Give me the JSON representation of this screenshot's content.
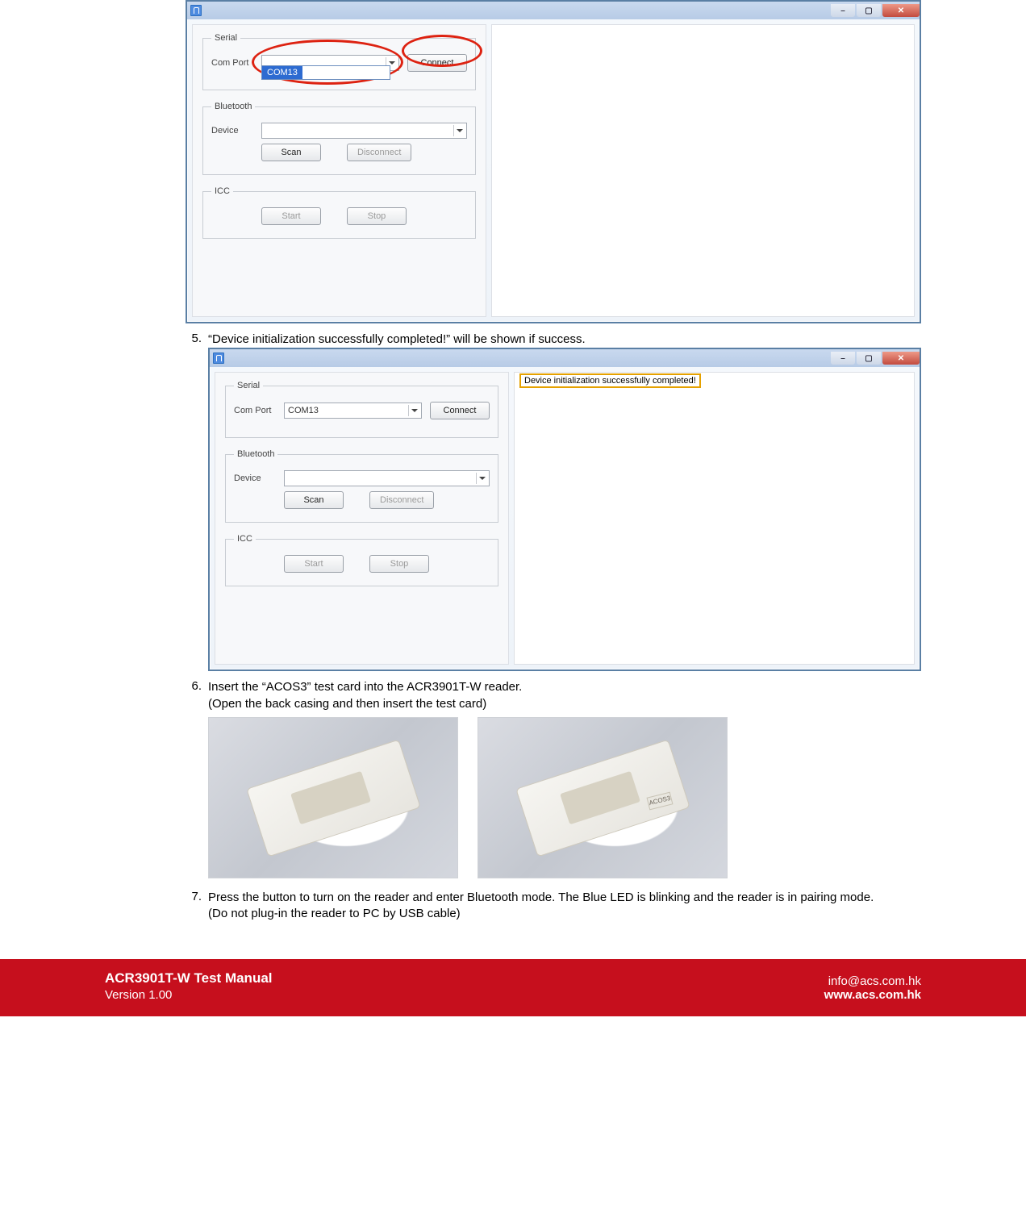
{
  "screenshot1": {
    "titlebar": {
      "icon": "bluetooth-icon"
    },
    "win_controls": {
      "min": "–",
      "max": "▢",
      "close": "✕"
    },
    "serial": {
      "legend": "Serial",
      "comport_label": "Com Port",
      "combo_value": "",
      "dropdown_option": "COM13",
      "connect_btn": "Connect"
    },
    "bluetooth": {
      "legend": "Bluetooth",
      "device_label": "Device",
      "combo_value": "",
      "scan_btn": "Scan",
      "disconnect_btn": "Disconnect"
    },
    "icc": {
      "legend": "ICC",
      "start_btn": "Start",
      "stop_btn": "Stop"
    },
    "log": ""
  },
  "step5": {
    "num": "5.",
    "text": "“Device initialization successfully completed!” will be shown if success."
  },
  "screenshot2": {
    "titlebar": {
      "icon": "bluetooth-icon"
    },
    "win_controls": {
      "min": "–",
      "max": "▢",
      "close": "✕"
    },
    "serial": {
      "legend": "Serial",
      "comport_label": "Com Port",
      "combo_value": "COM13",
      "connect_btn": "Connect"
    },
    "bluetooth": {
      "legend": "Bluetooth",
      "device_label": "Device",
      "combo_value": "",
      "scan_btn": "Scan",
      "disconnect_btn": "Disconnect"
    },
    "icc": {
      "legend": "ICC",
      "start_btn": "Start",
      "stop_btn": "Stop"
    },
    "log_line": "Device initialization successfully completed!"
  },
  "step6": {
    "num": "6.",
    "line1": "Insert the “ACOS3” test card into the ACR3901T-W reader.",
    "line2": "(Open the back casing and then insert the test card)",
    "photo2_card_label": "ACOS3"
  },
  "step7": {
    "num": "7.",
    "line1": "Press the button to turn on the reader and enter Bluetooth mode. The Blue LED is blinking and the reader is in pairing mode.",
    "line2": "(Do not plug-in the reader to PC by USB cable)"
  },
  "footer": {
    "title": "ACR3901T-W Test Manual",
    "version": "Version 1.00",
    "email": "info@acs.com.hk",
    "url": "www.acs.com.hk"
  }
}
